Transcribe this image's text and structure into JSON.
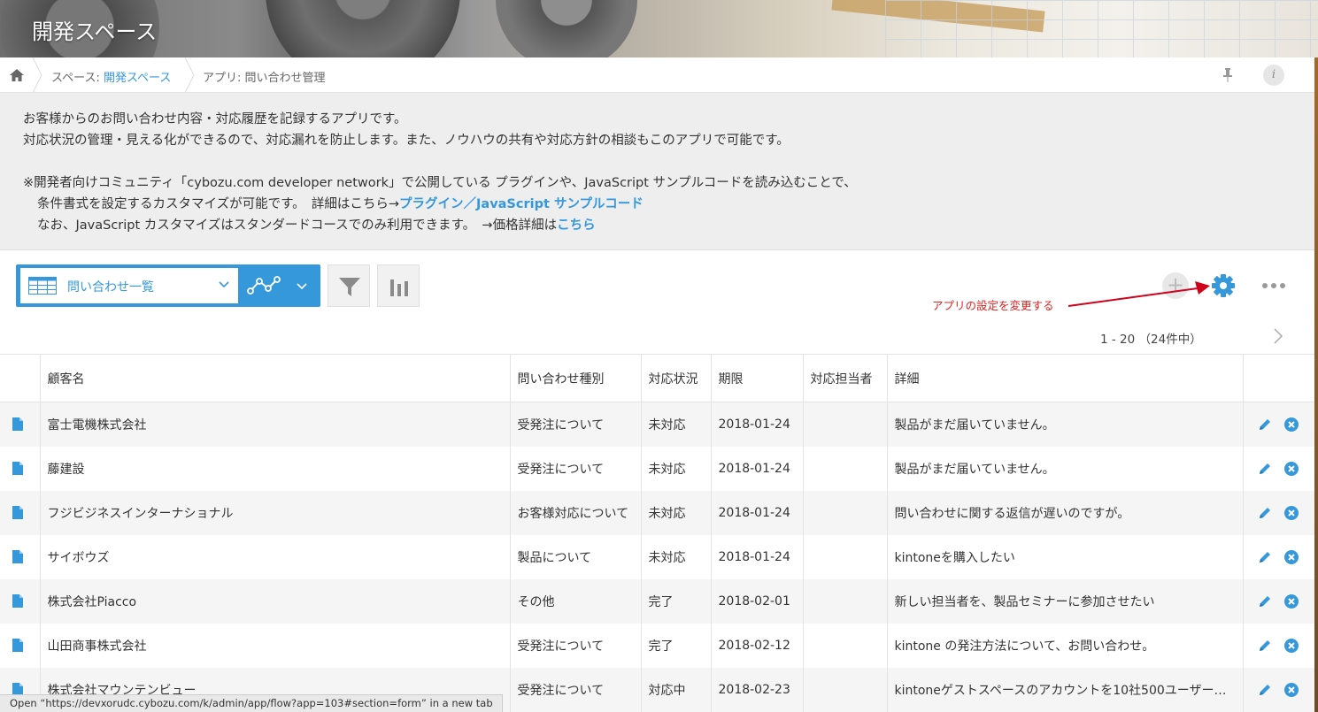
{
  "header": {
    "title": "開発スペース"
  },
  "breadcrumb": {
    "space_prefix": "スペース: ",
    "space_link": "開発スペース",
    "app_label": "アプリ: 問い合わせ管理"
  },
  "description": {
    "line1": "お客様からのお問い合わせ内容・対応履歴を記録するアプリです。",
    "line2": "対応状況の管理・見える化ができるので、対応漏れを防止します。また、ノウハウの共有や対応方針の相談もこのアプリで可能です。",
    "line3": "※開発者向けコミュニティ「cybozu.com developer network」で公開している プラグインや、JavaScript サンプルコードを読み込むことで、",
    "line4_text": "条件書式を設定するカスタマイズが可能です。　詳細はこちら→",
    "line4_link1": "プラグイン",
    "line4_sep": "／",
    "line4_link2": "JavaScript サンプルコード",
    "line5_text": "なお、JavaScript カスタマイズはスタンダードコースでのみ利用できます。　→価格詳細は",
    "line5_link": "こちら"
  },
  "toolbar": {
    "view_label": "問い合わせ一覧",
    "add_label": "+",
    "annotation": "アプリの設定を変更する",
    "pager": "1 - 20 （24件中）"
  },
  "table": {
    "columns": [
      "顧客名",
      "問い合わせ種別",
      "対応状況",
      "期限",
      "対応担当者",
      "詳細"
    ],
    "rows": [
      {
        "customer": "富士電機株式会社",
        "type": "受発注について",
        "status": "未対応",
        "due": "2018-01-24",
        "assignee": "",
        "detail": "製品がまだ届いていません。"
      },
      {
        "customer": "藤建設",
        "type": "受発注について",
        "status": "未対応",
        "due": "2018-01-24",
        "assignee": "",
        "detail": "製品がまだ届いていません。"
      },
      {
        "customer": "フジビジネスインターナショナル",
        "type": "お客様対応について",
        "status": "未対応",
        "due": "2018-01-24",
        "assignee": "",
        "detail": "問い合わせに関する返信が遅いのですが。"
      },
      {
        "customer": "サイボウズ",
        "type": "製品について",
        "status": "未対応",
        "due": "2018-01-24",
        "assignee": "",
        "detail": "kintoneを購入したい"
      },
      {
        "customer": "株式会社Piacco",
        "type": "その他",
        "status": "完了",
        "due": "2018-02-01",
        "assignee": "",
        "detail": "新しい担当者を、製品セミナーに参加させたい"
      },
      {
        "customer": "山田商事株式会社",
        "type": "受発注について",
        "status": "完了",
        "due": "2018-02-12",
        "assignee": "",
        "detail": "kintone の発注方法について、お問い合わせ。"
      },
      {
        "customer": "株式会社マウンテンビュー",
        "type": "受発注について",
        "status": "対応中",
        "due": "2018-02-23",
        "assignee": "",
        "detail": "kintoneゲストスペースのアカウントを10社500ユーザー…"
      }
    ]
  },
  "statusbar": {
    "text": "Open “https://devxorudc.cybozu.com/k/admin/app/flow?app=103#section=form” in a new tab"
  },
  "colors": {
    "accent": "#3498db",
    "annotation": "#e02020",
    "description_bg": "#eeeeee"
  },
  "icons": [
    "home-icon",
    "pin-icon",
    "info-icon",
    "table-view-icon",
    "chevron-down-icon",
    "graph-icon",
    "filter-icon",
    "chart-icon",
    "plus-icon",
    "gear-icon",
    "more-icon",
    "chevron-right-icon",
    "document-icon",
    "pencil-icon",
    "delete-icon"
  ]
}
